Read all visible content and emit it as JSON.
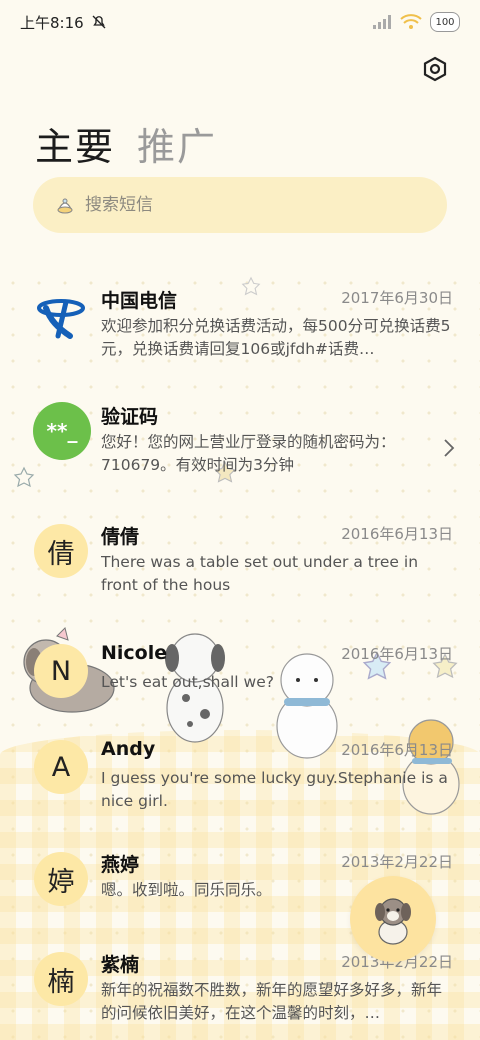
{
  "status_bar": {
    "time": "上午8:16",
    "battery": "100",
    "icons": [
      "mute-icon",
      "signal-icon",
      "wifi-icon",
      "battery-icon"
    ]
  },
  "header": {
    "settings_icon": "gear-icon",
    "tabs": [
      {
        "label": "主要",
        "active": true
      },
      {
        "label": "推广",
        "active": false
      }
    ]
  },
  "search": {
    "placeholder": "搜索短信",
    "icon": "search-icon"
  },
  "conversations": [
    {
      "name": "中国电信",
      "date": "2017年6月30日",
      "avatar": "telecom-logo",
      "preview": "欢迎参加积分兑换话费活动，每500分可兑换话费5元，兑换话费请回复106或jfdh#话费…"
    },
    {
      "name": "验证码",
      "date": "",
      "avatar": "**_",
      "preview": "您好！您的网上营业厅登录的随机密码为：710679。有效时间为3分钟"
    },
    {
      "name": "倩倩",
      "date": "2016年6月13日",
      "avatar": "倩",
      "preview": "There was a table set out under a tree in front of the hous"
    },
    {
      "name": "Nicole",
      "date": "2016年6月13日",
      "avatar": "N",
      "preview": "Let's eat out,shall we?"
    },
    {
      "name": "Andy",
      "date": "2016年6月13日",
      "avatar": "A",
      "preview": "I guess you're some lucky guy.Stephanie is a nice girl."
    },
    {
      "name": "燕婷",
      "date": "2013年2月22日",
      "avatar": "婷",
      "preview": "嗯。收到啦。同乐同乐。"
    },
    {
      "name": "紫楠",
      "date": "2013年2月22日",
      "avatar": "楠",
      "preview": "新年的祝福数不胜数，新年的愿望好多好多，新年的问候依旧美好，在这个温馨的时刻，…"
    }
  ],
  "colors": {
    "background": "#fdfaf0",
    "search_bg": "#fbefc5",
    "avatar_bg": "#fde8a6",
    "verify_avatar_bg": "#6cc04a",
    "telecom_blue": "#1560b8"
  },
  "fab": {
    "icon": "compose-dog-icon"
  }
}
